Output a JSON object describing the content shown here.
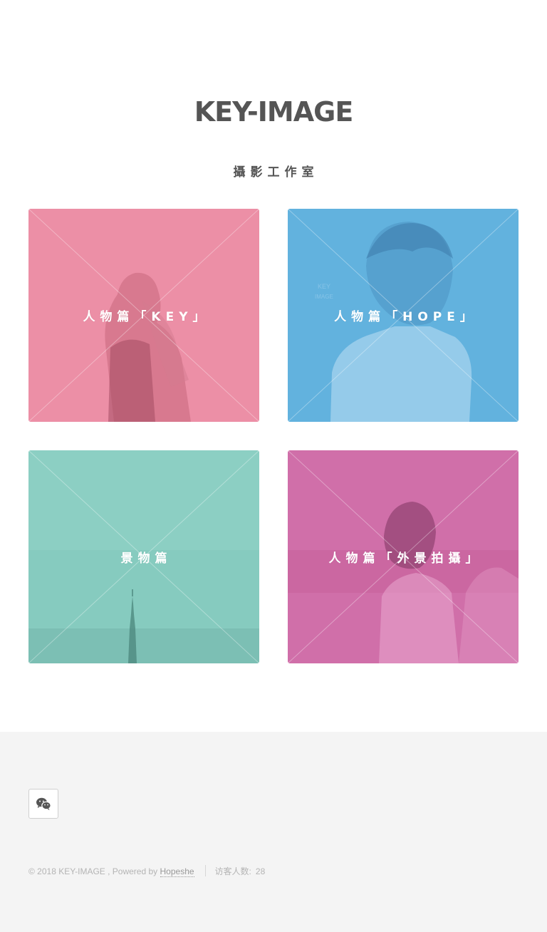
{
  "header": {
    "title": "KEY-IMAGE",
    "subtitle": "攝影工作室"
  },
  "gallery": {
    "cards": [
      {
        "label": "人物篇「KEY」",
        "color": "#ec8fa6"
      },
      {
        "label": "人物篇「HOPE」",
        "color": "#62b2de"
      },
      {
        "label": "景物篇",
        "color": "#86cbbf"
      },
      {
        "label": "人物篇「外景拍攝」",
        "color": "#d06fa9"
      }
    ]
  },
  "footer": {
    "social_icon": "wechat-icon",
    "copyright": "© 2018 KEY-IMAGE , Powered by ",
    "powered_link": "Hopeshe",
    "visitor_label": "访客人数:",
    "visitor_count": "28"
  },
  "colors": {
    "title": "#555555",
    "footer_bg": "#f4f4f4",
    "footer_text": "#b4b4b4"
  }
}
